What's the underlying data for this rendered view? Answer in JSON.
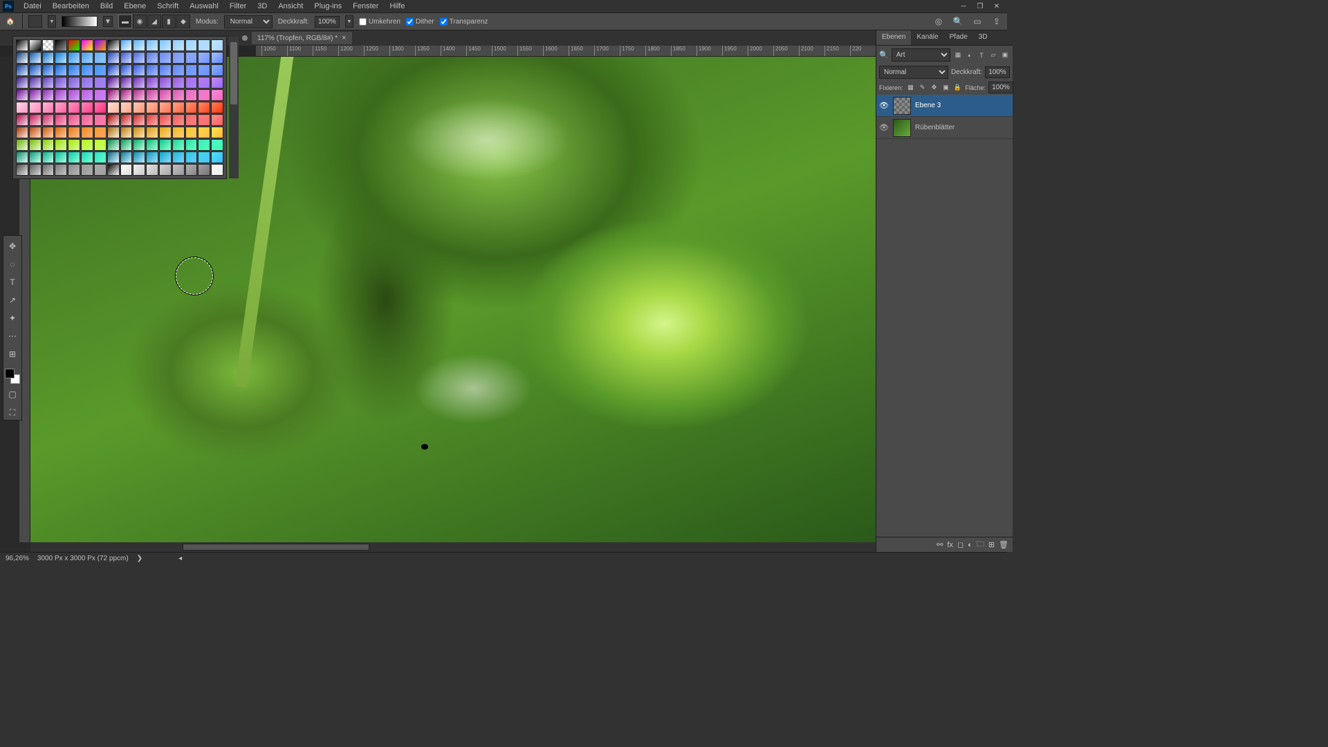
{
  "menu": {
    "items": [
      "Datei",
      "Bearbeiten",
      "Bild",
      "Ebene",
      "Schrift",
      "Auswahl",
      "Filter",
      "3D",
      "Ansicht",
      "Plug-ins",
      "Fenster",
      "Hilfe"
    ]
  },
  "opt": {
    "modus_label": "Modus:",
    "modus_value": "Normal",
    "deck_label": "Deckkraft:",
    "deck_value": "100%",
    "umkehren": "Umkehren",
    "dither": "Dither",
    "transparenz": "Transparenz"
  },
  "doc": {
    "tab_title": "117% (Tropfen, RGB/8#) *",
    "ruler_ticks": [
      "1050",
      "1100",
      "1150",
      "1200",
      "1250",
      "1300",
      "1350",
      "1400",
      "1450",
      "1500",
      "1550",
      "1600",
      "1650",
      "1700",
      "1750",
      "1800",
      "1850",
      "1900",
      "1950",
      "2000",
      "2050",
      "2100",
      "2150",
      "220"
    ]
  },
  "status": {
    "zoom": "96,26%",
    "info": "3000 Px x 3000 Px (72 ppcm)"
  },
  "panels": {
    "tabs": [
      "Ebenen",
      "Kanäle",
      "Pfade",
      "3D"
    ],
    "search_label": "Art",
    "blend_mode": "Normal",
    "opacity_label": "Deckkraft:",
    "opacity_value": "100%",
    "lock_label": "Fixieren:",
    "fill_label": "Fläche:",
    "fill_value": "100%",
    "layers": [
      {
        "name": "Ebene 3",
        "selected": true,
        "kind": "empty"
      },
      {
        "name": "Rübenblätter",
        "selected": false,
        "kind": "green"
      }
    ]
  },
  "swatches": {
    "rows": [
      [
        "#000000/#ffffff",
        "#ffffff/#000000",
        "transparent",
        "#000000/#999999",
        "#ff0000/#00ff00",
        "#ff00ff/#ffff00",
        "#8800ff/#ffaa00",
        "#000000/#ffffff",
        "#4aa8ff/#ffffff",
        "#5ab3ff/#e0f0ff",
        "#6abaff/#d8ecff",
        "#7ac4ff/#cfe8ff",
        "#8aceff/#c8e4ff",
        "#9ad7ff/#c0dfff",
        "#aadeff/#b8dbff",
        "#bae6ff/#b0d6ff"
      ],
      [
        "#0a3a7a/#ffffff",
        "#0b5aaa/#e8f4ff",
        "#0c6abf/#d4ecff",
        "#0d7ad4/#c0e4ff",
        "#2a8ae2/#b0dcff",
        "#4a9ae8/#a0d4ff",
        "#6aaaee/#90ccff",
        "#2244bb/#e0e8ff",
        "#3a58cc/#d0dcff",
        "#4a68d6/#c0d0ff",
        "#5a78de/#b0c4ff",
        "#6a88e6/#a0b8ff",
        "#7a98ec/#90acff",
        "#8aa8f2/#80a0ff",
        "#9ab6f6/#7094ff",
        "#aac4fa/#6088ff"
      ],
      [
        "#0a3a9a/#ddeeff",
        "#0a4ab0/#ccddff",
        "#0a5ac4/#bbd0ff",
        "#0a6ad8/#aac4ff",
        "#1a7ae4/#99b8ff",
        "#2a8aec/#88acff",
        "#3a9af2/#77a0ff",
        "#0a3abb/#e0e6ff",
        "#1a4acc/#d0d8ff",
        "#2a5add/#c0ccff",
        "#3a68e6/#b0c0ff",
        "#4a78ee/#a0b4ff",
        "#5a86f4/#90a8ff",
        "#6a96f8/#809cff",
        "#7aa4fc/#7090ff",
        "#8ab2ff/#6084ff"
      ],
      [
        "#3a1a8a/#e8e0ff",
        "#4a2a9a/#dcd0ff",
        "#5a3aaa/#d0c0ff",
        "#6a4aba/#c4b0ff",
        "#7a5ac8/#b8a0ff",
        "#8a6ad4/#ac92ff",
        "#9a7ae0/#a084ff",
        "#4a0a8a/#f0e0ff",
        "#5a1a9a/#e4d0ff",
        "#6a2aaa/#d8c0ff",
        "#7a3aba/#ccb0ff",
        "#8a4ac8/#c0a0ff",
        "#9a5ad4/#b492ff",
        "#aa6ae0/#a884ff",
        "#ba7aea/#9c76ff",
        "#ca8af4/#9068ff"
      ],
      [
        "#6a0a8a/#f4e0ff",
        "#7a1a9a/#ecd0ff",
        "#8a2aaa/#e4c0ff",
        "#9a3aba/#dcb0ff",
        "#aa4ac8/#d4a0ff",
        "#ba5ad4/#cc92ff",
        "#ca6ae0/#c484ff",
        "#8a0a6a/#ffe0f4",
        "#9a1a7a/#ffd0ec",
        "#aa2a8a/#ffc0e4",
        "#ba3a9a/#ffb0dc",
        "#c84aaa/#ffa0d4",
        "#d45aba/#ff92cc",
        "#e06aca/#ff84c4",
        "#ea7ad8/#ff76bc",
        "#f48ae6/#ff68b4"
      ],
      [
        "#ffd8ea/#ff9ac8",
        "#ffc8e0/#ff88bc",
        "#ffb8d6/#ff76b0",
        "#ffa8cc/#ff64a4",
        "#ff98c2/#ff5298",
        "#ff88b8/#ff408c",
        "#ff78ae/#ff2e80",
        "#ffe0d8/#ffb49a",
        "#ffd4c8/#ffa488",
        "#ffc8b8/#ff9476",
        "#ffbca8/#ff8464",
        "#ffb098/#ff7452",
        "#ffa488/#ff6440",
        "#ff9878/#ff542e",
        "#ff8c68/#ff441c",
        "#ff8058/#ff340a"
      ],
      [
        "#aa0a4a/#ffe0ec",
        "#ba1a5a/#ffd0e0",
        "#ca2a6a/#ffc0d4",
        "#d83a7a/#ffb0c8",
        "#e44a8a/#ffa0bc",
        "#ee5a9a/#ff90b0",
        "#f66aaa/#ff80a4",
        "#aa0a0a/#ffe0e0",
        "#ba1a1a/#ffd0d0",
        "#ca2a2a/#ffc0c0",
        "#d83a3a/#ffb0b0",
        "#e44a4a/#ffa0a0",
        "#ee5a5a/#ff9090",
        "#f66a6a/#ff8080",
        "#fc7a7a/#ff7070",
        "#ff8a8a/#ff6060"
      ],
      [
        "#aa3a0a/#ffece0",
        "#ba4a0a/#ffe0cc",
        "#ca5a0a/#ffd4b8",
        "#d86a0a/#ffc8a4",
        "#e47a0a/#ffbc90",
        "#ee8a1a/#ffb07c",
        "#f69a2a/#ffa468",
        "#aa6a0a/#fff4e0",
        "#ba7a0a/#ffeccc",
        "#ca8a0a/#ffe4b8",
        "#d89a0a/#ffdca4",
        "#e4aa0a/#ffd490",
        "#eeba1a/#ffcc7c",
        "#f6ca2a/#ffc468",
        "#fcda3a/#ffbc54",
        "#ffea4a/#ffb440"
      ],
      [
        "#6aaa0a/#f0ffe0",
        "#7aba0a/#e8ffcc",
        "#8aca0a/#e0ffb8",
        "#9ad80a/#d8ffa4",
        "#aae40a/#d0ff90",
        "#baee1a/#c8ff7c",
        "#caf62a/#c0ff68",
        "#0a8a4a/#e0fff0",
        "#0a9a5a/#ccffe8",
        "#0aaa6a/#b8ffe0",
        "#0aba7a/#a4ffd8",
        "#0ac88a/#90ffd0",
        "#1ad49a/#7cffc8",
        "#2ae0aa/#68ffc0",
        "#3aeaba/#54ffb8",
        "#4af4ca/#40ffb0"
      ],
      [
        "#0a8a6a/#e0fff8",
        "#0a9a7a/#ccfff0",
        "#0aaa8a/#b8ffe8",
        "#0aba9a/#a4ffe0",
        "#0ac8aa/#90ffd8",
        "#1ad4ba/#7cffd0",
        "#2ae0ca/#68ffc8",
        "#0a6a8a/#e0f8ff",
        "#0a7a9a/#ccf0ff",
        "#0a8aaa/#b8e8ff",
        "#0a9aba/#a4e0ff",
        "#0aaac8/#90d8ff",
        "#1abad4/#7cd0ff",
        "#2acae0/#68c8ff",
        "#3ad8ea/#54c0ff",
        "#4ae6f4/#40b8ff"
      ],
      [
        "#4a4a4a/#e8e8e8",
        "#5a5a5a/#dcdcdc",
        "#6a6a6a/#d0d0d0",
        "#7a7a7a/#c4c4c4",
        "#8a8a8a/#b8b8b8",
        "#9a9a9a/#acacac",
        "#aaaaaa/#a0a0a0",
        "#0a0a0a/#f8f8f8",
        "#ffffff/#dddddd",
        "#f0f0f0/#cccccc",
        "#e0e0e0/#bbbbbb",
        "#d0d0d0/#aaaaaa",
        "#c0c0c0/#999999",
        "#b0b0b0/#888888",
        "#a0a0a0/#777777",
        "#f8f8f8/#eeeeee"
      ]
    ]
  }
}
